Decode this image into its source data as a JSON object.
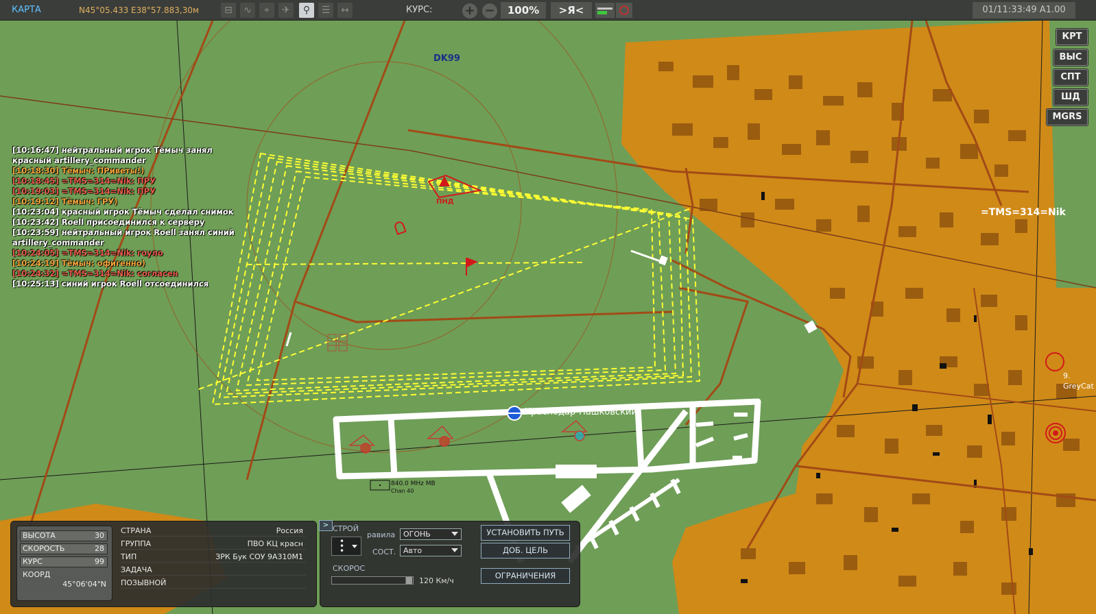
{
  "topbar": {
    "title": "КАРТА",
    "coordinates": "N45°05.433 E38°57.883,30м",
    "course_label": "КУРС:",
    "zoom_in": "+",
    "zoom_out": "−",
    "zoom_level": "100%",
    "center_on_me": ">Я<",
    "datetime": "01/11:33:49 A1.00",
    "tools": [
      "ruler-icon",
      "path-icon",
      "target-icon",
      "radar-icon",
      "satellite-icon",
      "notes-icon",
      "measure-icon"
    ],
    "active_tool_index": 4
  },
  "right_buttons": [
    "КРТ",
    "ВЫС",
    "СПТ",
    "ШД",
    "MGRS"
  ],
  "map_labels": {
    "grid": "DK99",
    "player": "=TMS=314=Nik",
    "contact_number": "9.",
    "contact_name": "GreyCat",
    "unit_tag": "ПНД",
    "airfield": "Краснодар-Пашковский",
    "beacon_freq": "840.0 MHz MB",
    "beacon_chan": "Chan 40"
  },
  "chat": [
    {
      "text": "[10:16:47] нейтральный игрок Тёмыч занял",
      "color": "white"
    },
    {
      "text": "красный artillery_commander",
      "color": "white"
    },
    {
      "text": "[10:18:30] Тёмыч: ПРиветы!)",
      "color": "orange"
    },
    {
      "text": "[10:18:45] =TMS=314=Nik: ПРУ",
      "color": "red"
    },
    {
      "text": "[10:19:03] =TMS=314=Nik: ПРУ",
      "color": "red"
    },
    {
      "text": "[10:19:12] Тёмыч: ГРУ)",
      "color": "orange"
    },
    {
      "text": "[10:23:04] красный игрок Тёмыч сделал снимок",
      "color": "white"
    },
    {
      "text": "[10:23:42] Roell присоединился к серверу",
      "color": "white"
    },
    {
      "text": "[10:23:59] нейтральный игрок Roell занял синий",
      "color": "white"
    },
    {
      "text": "artillery_commander",
      "color": "white"
    },
    {
      "text": "[10:24:05] =TMS=314=Nik: гоуло",
      "color": "red"
    },
    {
      "text": "[10:24:19] Тёмыч: офигенно)",
      "color": "orange"
    },
    {
      "text": "[10:24:32] =TMS=314=Nik: согласен",
      "color": "red"
    },
    {
      "text": "[10:25:13] синий игрок Roell отсоединился",
      "color": "white"
    }
  ],
  "unit_panel": {
    "stats": [
      {
        "label": "ВЫСОТА",
        "value": "30"
      },
      {
        "label": "СКОРОСТЬ",
        "value": "28"
      },
      {
        "label": "КУРС",
        "value": "99"
      }
    ],
    "coord_label": "КООРД",
    "coord_value": "45°06'04\"N",
    "info": [
      {
        "label": "СТРАНА",
        "value": "Россия"
      },
      {
        "label": "ГРУППА",
        "value": "ПВО КЦ красн"
      },
      {
        "label": "ТИП",
        "value": "ЗРК Бук СОУ 9А310М1"
      },
      {
        "label": "ЗАДАЧА",
        "value": ""
      },
      {
        "label": "ПОЗЫВНОЙ",
        "value": ""
      }
    ]
  },
  "orders_panel": {
    "toggle": ">",
    "formation_label": "СТРОЙ",
    "rules_label": "равила",
    "rules_value": "ОГОНЬ",
    "state_label": "СОСТ.",
    "state_value": "Авто",
    "speed_label": "СКОРОС",
    "speed_value": "120 Км/ч",
    "speed_fraction": 1.0,
    "set_path": "УСТАНОВИТЬ ПУТЬ",
    "add_target": "ДОБ. ЦЕЛЬ",
    "restrictions": "ОГРАНИЧЕНИЯ"
  },
  "colors": {
    "grass": "#6f9e57",
    "urban": "#d08a18",
    "road": "#a24a16",
    "zone": "#ffff33",
    "hostile": "#d21919"
  }
}
